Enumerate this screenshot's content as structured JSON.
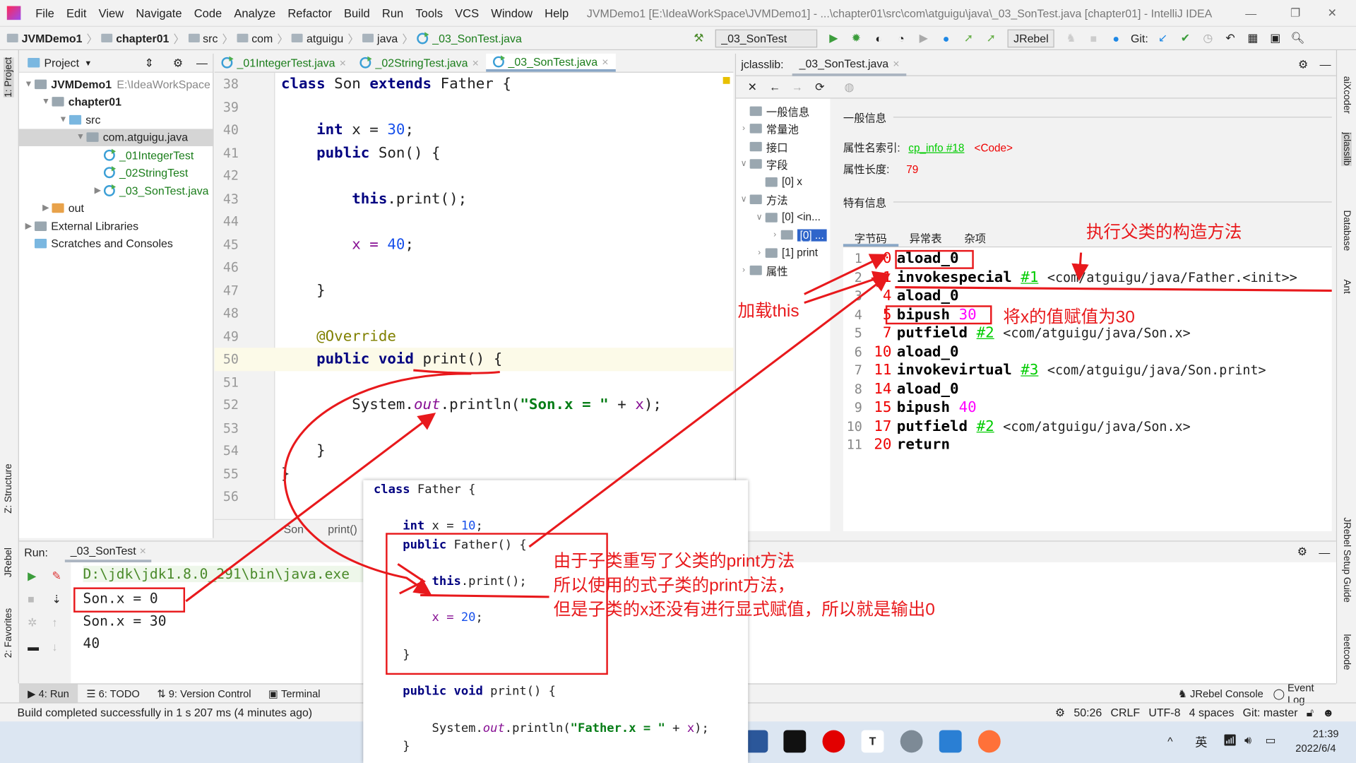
{
  "window": {
    "title": "JVMDemo1 [E:\\IdeaWorkSpace\\JVMDemo1] - ...\\chapter01\\src\\com\\atguigu\\java\\_03_SonTest.java [chapter01] - IntelliJ IDEA"
  },
  "menu": [
    "File",
    "Edit",
    "View",
    "Navigate",
    "Code",
    "Analyze",
    "Refactor",
    "Build",
    "Run",
    "Tools",
    "VCS",
    "Window",
    "Help"
  ],
  "breadcrumb": [
    "JVMDemo1",
    "chapter01",
    "src",
    "com",
    "atguigu",
    "java",
    "_03_SonTest.java"
  ],
  "toolbar": {
    "run_config": "_03_SonTest",
    "jrebel": "JRebel",
    "git_label": "Git:"
  },
  "project": {
    "title": "Project",
    "tree": [
      {
        "label": "JVMDemo1",
        "extra": "E:\\IdeaWorkSpace",
        "depth": 0,
        "arrow": "v",
        "icon": "module",
        "bold": true
      },
      {
        "label": "chapter01",
        "depth": 1,
        "arrow": "v",
        "icon": "module",
        "bold": true
      },
      {
        "label": "src",
        "depth": 2,
        "arrow": "v",
        "icon": "src"
      },
      {
        "label": "com.atguigu.java",
        "depth": 3,
        "arrow": "v",
        "icon": "package",
        "selected": true
      },
      {
        "label": "_01IntegerTest",
        "depth": 4,
        "arrow": "",
        "icon": "class"
      },
      {
        "label": "_02StringTest",
        "depth": 4,
        "arrow": "",
        "icon": "class"
      },
      {
        "label": "_03_SonTest.java",
        "depth": 4,
        "arrow": ">",
        "icon": "class"
      },
      {
        "label": "out",
        "depth": 1,
        "arrow": ">",
        "icon": "out"
      },
      {
        "label": "External Libraries",
        "depth": 0,
        "arrow": ">",
        "icon": "lib"
      },
      {
        "label": "Scratches and Consoles",
        "depth": 0,
        "arrow": "",
        "icon": "scratch"
      }
    ]
  },
  "editor": {
    "tabs": [
      {
        "label": "_01IntegerTest.java"
      },
      {
        "label": "_02StringTest.java"
      },
      {
        "label": "_03_SonTest.java",
        "active": true
      }
    ],
    "lines": [
      {
        "n": "38",
        "t": [
          [
            "class ",
            "kw"
          ],
          [
            "Son ",
            ""
          ],
          [
            "extends ",
            "kw"
          ],
          [
            "Father {",
            ""
          ]
        ]
      },
      {
        "n": "39",
        "t": []
      },
      {
        "n": "40",
        "t": [
          [
            "    int ",
            "kw"
          ],
          [
            "x = ",
            ""
          ],
          [
            "30",
            "num"
          ],
          [
            ";",
            ""
          ]
        ]
      },
      {
        "n": "41",
        "t": [
          [
            "    public ",
            "kw"
          ],
          [
            "Son() {",
            ""
          ]
        ]
      },
      {
        "n": "42",
        "t": []
      },
      {
        "n": "43",
        "t": [
          [
            "        this",
            "kw"
          ],
          [
            ".print();",
            ""
          ]
        ]
      },
      {
        "n": "44",
        "t": []
      },
      {
        "n": "45",
        "t": [
          [
            "        x = ",
            "var"
          ],
          [
            "40",
            "num"
          ],
          [
            ";",
            ""
          ]
        ]
      },
      {
        "n": "46",
        "t": []
      },
      {
        "n": "47",
        "t": [
          [
            "    }",
            ""
          ]
        ]
      },
      {
        "n": "48",
        "t": []
      },
      {
        "n": "49",
        "t": [
          [
            "    @Override",
            "ann"
          ]
        ]
      },
      {
        "n": "50",
        "t": [
          [
            "    public void ",
            "kw"
          ],
          [
            "print() {",
            ""
          ]
        ],
        "current": true
      },
      {
        "n": "51",
        "t": []
      },
      {
        "n": "52",
        "t": [
          [
            "        System.",
            ""
          ],
          [
            "out",
            "fld"
          ],
          [
            ".println(",
            ""
          ],
          [
            "\"Son.x = \"",
            "str"
          ],
          [
            " + ",
            ""
          ],
          [
            "x",
            "var"
          ],
          [
            ");",
            ""
          ]
        ]
      },
      {
        "n": "53",
        "t": []
      },
      {
        "n": "54",
        "t": [
          [
            "    }",
            ""
          ]
        ]
      },
      {
        "n": "55",
        "t": [
          [
            "}",
            ""
          ]
        ]
      },
      {
        "n": "56",
        "t": []
      }
    ],
    "crumb": [
      "Son",
      "print()"
    ]
  },
  "jclasslib": {
    "title": "jclasslib:",
    "tab": "_03_SonTest.java",
    "tree": [
      {
        "label": "一般信息",
        "depth": 0,
        "arrow": ""
      },
      {
        "label": "常量池",
        "depth": 0,
        "arrow": ">"
      },
      {
        "label": "接口",
        "depth": 0,
        "arrow": ""
      },
      {
        "label": "字段",
        "depth": 0,
        "arrow": "v"
      },
      {
        "label": "[0] x",
        "depth": 1,
        "arrow": ""
      },
      {
        "label": "方法",
        "depth": 0,
        "arrow": "v"
      },
      {
        "label": "[0] <in...",
        "depth": 1,
        "arrow": "v"
      },
      {
        "label": "[0] ...",
        "depth": 2,
        "arrow": ">",
        "selected": true
      },
      {
        "label": "[1] print",
        "depth": 1,
        "arrow": ">"
      },
      {
        "label": "属性",
        "depth": 0,
        "arrow": ">"
      }
    ],
    "general_title": "一般信息",
    "attr_name_label": "属性名索引:",
    "attr_name_ref": "cp_info #18",
    "attr_name_value": "<Code>",
    "attr_len_label": "属性长度:",
    "attr_len_value": "79",
    "specific_title": "特有信息",
    "tabs": [
      "字节码",
      "异常表",
      "杂项"
    ],
    "bytecode": [
      {
        "n": "1",
        "o": "0",
        "op": "aload_0"
      },
      {
        "n": "2",
        "o": "1",
        "op": "invokespecial",
        "ref": "#1",
        "arg": "<com/atguigu/java/Father.<init>>"
      },
      {
        "n": "3",
        "o": "4",
        "op": "aload_0"
      },
      {
        "n": "4",
        "o": "5",
        "op": "bipush",
        "val": "30"
      },
      {
        "n": "5",
        "o": "7",
        "op": "putfield",
        "ref": "#2",
        "arg": "<com/atguigu/java/Son.x>"
      },
      {
        "n": "6",
        "o": "10",
        "op": "aload_0"
      },
      {
        "n": "7",
        "o": "11",
        "op": "invokevirtual",
        "ref": "#3",
        "arg": "<com/atguigu/java/Son.print>"
      },
      {
        "n": "8",
        "o": "14",
        "op": "aload_0"
      },
      {
        "n": "9",
        "o": "15",
        "op": "bipush",
        "val": "40"
      },
      {
        "n": "10",
        "o": "17",
        "op": "putfield",
        "ref": "#2",
        "arg": "<com/atguigu/java/Son.x>"
      },
      {
        "n": "11",
        "o": "20",
        "op": "return"
      }
    ]
  },
  "run": {
    "label": "Run:",
    "tab": "_03_SonTest",
    "cmd": "D:\\jdk\\jdk1.8.0_291\\bin\\java.exe",
    "output": [
      "Son.x = 0",
      "Son.x = 30",
      "40"
    ]
  },
  "father_popup": {
    "lines": [
      [
        [
          "class ",
          "kw"
        ],
        [
          "Father {",
          ""
        ]
      ],
      [],
      [
        [
          "    int ",
          "kw"
        ],
        [
          "x = ",
          ""
        ],
        [
          "10",
          "num"
        ],
        [
          ";",
          ""
        ]
      ],
      [
        [
          "    public ",
          "kw"
        ],
        [
          "Father() {",
          ""
        ]
      ],
      [],
      [
        [
          "        this",
          "kw"
        ],
        [
          ".print();",
          ""
        ]
      ],
      [],
      [
        [
          "        x = ",
          "var"
        ],
        [
          "20",
          "num"
        ],
        [
          ";",
          ""
        ]
      ],
      [],
      [
        [
          "    }",
          ""
        ]
      ],
      [],
      [
        [
          "    public void ",
          "kw"
        ],
        [
          "print() {",
          ""
        ]
      ],
      [],
      [
        [
          "        System.",
          ""
        ],
        [
          "out",
          "fld"
        ],
        [
          ".println(",
          ""
        ],
        [
          "\"Father.x = \"",
          "str"
        ],
        [
          " + ",
          ""
        ],
        [
          "x",
          "var"
        ],
        [
          ");",
          ""
        ]
      ],
      [
        [
          "    }",
          ""
        ]
      ]
    ]
  },
  "annotations": {
    "call_parent_ctor": "执行父类的构造方法",
    "load_this": "加载this",
    "assign_30": "将x的值赋值为30",
    "explain": [
      "由于子类重写了父类的print方法",
      "所以使用的式子类的print方法，",
      "但是子类的x还没有进行显式赋值，所以就是输出0"
    ]
  },
  "bottom_tools": [
    "4: Run",
    "6: TODO",
    "9: Version Control",
    "Terminal"
  ],
  "bottom_right_tools": [
    "JRebel Console",
    "Event Log"
  ],
  "status": {
    "message": "Build completed successfully in 1 s 207 ms (4 minutes ago)",
    "position": "50:26",
    "line_sep": "CRLF",
    "encoding": "UTF-8",
    "indent": "4 spaces",
    "git": "Git: master"
  },
  "side_left": [
    "1: Project",
    "Z: Structure",
    "JRebel",
    "2: Favorites"
  ],
  "side_right": [
    "aiXcoder",
    "jclasslib",
    "Database",
    "Ant",
    "JRebel Setup Guide",
    "leetcode"
  ],
  "taskbar": {
    "ime": "英",
    "time": "21:39",
    "date": "2022/6/4"
  },
  "colors": {
    "annotation": "#e8191c",
    "keyword": "#000080",
    "number": "#1750eb",
    "string": "#067d17"
  }
}
